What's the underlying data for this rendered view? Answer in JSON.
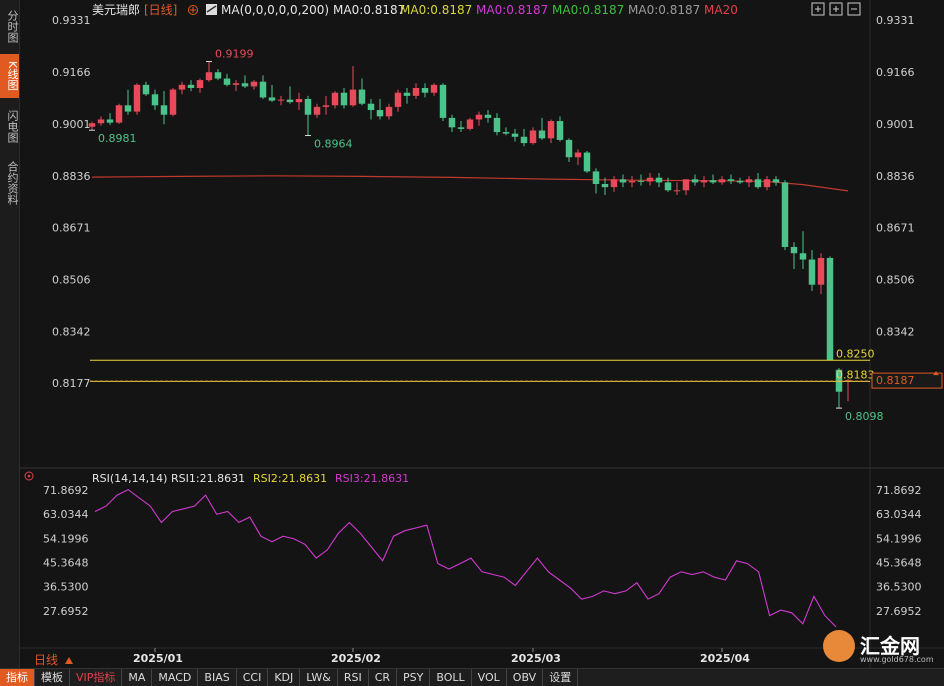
{
  "side_tabs": [
    "分时图",
    "K线图",
    "闪电图",
    "合约资料"
  ],
  "header": {
    "symbol": "美元瑞郎",
    "period": "[日线]",
    "period_icon": "circled-plus",
    "ma_title": "MA(0,0,0,0,0,200)",
    "ma_items": [
      {
        "label": "MA0:0.8187",
        "color": "#e6e6e6"
      },
      {
        "label": "MA0:0.8187",
        "color": "#d8d83a"
      },
      {
        "label": "MA0:0.8187",
        "color": "#d13ad1"
      },
      {
        "label": "MA0:0.8187",
        "color": "#3ac13a"
      },
      {
        "label": "MA0:0.8187",
        "color": "#9a9a9a"
      },
      {
        "label": "MA20",
        "color": "#e0404a"
      }
    ]
  },
  "rsi_header": {
    "title": "RSI(14,14,14)",
    "rsi1": "RSI1:21.8631",
    "rsi2": "RSI2:21.8631",
    "rsi3": "RSI3:21.8631"
  },
  "bottom_tabs": [
    "指标",
    "模板",
    "VIP指标",
    "MA",
    "MACD",
    "BIAS",
    "CCI",
    "KDJ",
    "LW&",
    "RSI",
    "CR",
    "PSY",
    "BOLL",
    "VOL",
    "OBV",
    "设置"
  ],
  "period_label": "日线",
  "logo": {
    "text": "汇金网",
    "url": "www.gold678.com"
  },
  "colors": {
    "up": "#e84a5a",
    "down": "#4cc38a",
    "ma_line": "#c0392b",
    "rsi_line": "#d13ad1",
    "level": "#e6d63a",
    "accent": "#e05a22"
  },
  "chart_data": [
    {
      "type": "candlestick",
      "title": "美元瑞郎 [日线]",
      "y_ticks": [
        "0.9331",
        "0.9166",
        "0.9001",
        "0.8836",
        "0.8671",
        "0.8506",
        "0.8342",
        "0.8177"
      ],
      "ylim": [
        0.8092,
        0.9331
      ],
      "x_labels": [
        {
          "index": 7,
          "label": "2025/01"
        },
        {
          "index": 29,
          "label": "2025/02"
        },
        {
          "index": 49,
          "label": "2025/03"
        },
        {
          "index": 70,
          "label": "2025/04"
        }
      ],
      "candles": [
        {
          "o": 0.8992,
          "h": 0.9008,
          "l": 0.8981,
          "c": 0.9003
        },
        {
          "o": 0.9003,
          "h": 0.9025,
          "l": 0.8995,
          "c": 0.9015
        },
        {
          "o": 0.9015,
          "h": 0.9035,
          "l": 0.8998,
          "c": 0.9005
        },
        {
          "o": 0.9005,
          "h": 0.9065,
          "l": 0.9001,
          "c": 0.906
        },
        {
          "o": 0.906,
          "h": 0.911,
          "l": 0.903,
          "c": 0.904
        },
        {
          "o": 0.904,
          "h": 0.913,
          "l": 0.903,
          "c": 0.9125
        },
        {
          "o": 0.9125,
          "h": 0.9135,
          "l": 0.909,
          "c": 0.9095
        },
        {
          "o": 0.9095,
          "h": 0.911,
          "l": 0.9045,
          "c": 0.906
        },
        {
          "o": 0.906,
          "h": 0.9105,
          "l": 0.9,
          "c": 0.903
        },
        {
          "o": 0.903,
          "h": 0.9115,
          "l": 0.9025,
          "c": 0.911
        },
        {
          "o": 0.911,
          "h": 0.9135,
          "l": 0.9095,
          "c": 0.9125
        },
        {
          "o": 0.9125,
          "h": 0.914,
          "l": 0.9105,
          "c": 0.9115
        },
        {
          "o": 0.9115,
          "h": 0.9145,
          "l": 0.91,
          "c": 0.914
        },
        {
          "o": 0.914,
          "h": 0.9199,
          "l": 0.9135,
          "c": 0.9165
        },
        {
          "o": 0.9165,
          "h": 0.9175,
          "l": 0.914,
          "c": 0.9145
        },
        {
          "o": 0.9145,
          "h": 0.916,
          "l": 0.912,
          "c": 0.9125
        },
        {
          "o": 0.9125,
          "h": 0.914,
          "l": 0.9105,
          "c": 0.913
        },
        {
          "o": 0.913,
          "h": 0.9155,
          "l": 0.9115,
          "c": 0.912
        },
        {
          "o": 0.912,
          "h": 0.914,
          "l": 0.911,
          "c": 0.9135
        },
        {
          "o": 0.9135,
          "h": 0.9155,
          "l": 0.908,
          "c": 0.9085
        },
        {
          "o": 0.9085,
          "h": 0.9125,
          "l": 0.907,
          "c": 0.9075
        },
        {
          "o": 0.9075,
          "h": 0.909,
          "l": 0.906,
          "c": 0.9078
        },
        {
          "o": 0.9078,
          "h": 0.912,
          "l": 0.9065,
          "c": 0.907
        },
        {
          "o": 0.907,
          "h": 0.91,
          "l": 0.9045,
          "c": 0.908
        },
        {
          "o": 0.908,
          "h": 0.909,
          "l": 0.8964,
          "c": 0.903
        },
        {
          "o": 0.903,
          "h": 0.9065,
          "l": 0.902,
          "c": 0.9055
        },
        {
          "o": 0.9055,
          "h": 0.909,
          "l": 0.903,
          "c": 0.906
        },
        {
          "o": 0.906,
          "h": 0.9105,
          "l": 0.905,
          "c": 0.91
        },
        {
          "o": 0.91,
          "h": 0.9115,
          "l": 0.905,
          "c": 0.906
        },
        {
          "o": 0.906,
          "h": 0.9185,
          "l": 0.9055,
          "c": 0.911
        },
        {
          "o": 0.911,
          "h": 0.9145,
          "l": 0.906,
          "c": 0.9065
        },
        {
          "o": 0.9065,
          "h": 0.908,
          "l": 0.9015,
          "c": 0.9045
        },
        {
          "o": 0.9045,
          "h": 0.908,
          "l": 0.9015,
          "c": 0.9025
        },
        {
          "o": 0.9025,
          "h": 0.9065,
          "l": 0.9015,
          "c": 0.9055
        },
        {
          "o": 0.9055,
          "h": 0.911,
          "l": 0.904,
          "c": 0.91
        },
        {
          "o": 0.91,
          "h": 0.9115,
          "l": 0.9065,
          "c": 0.909
        },
        {
          "o": 0.909,
          "h": 0.913,
          "l": 0.908,
          "c": 0.9115
        },
        {
          "o": 0.9115,
          "h": 0.913,
          "l": 0.9085,
          "c": 0.91
        },
        {
          "o": 0.91,
          "h": 0.913,
          "l": 0.909,
          "c": 0.9125
        },
        {
          "o": 0.9125,
          "h": 0.913,
          "l": 0.901,
          "c": 0.902
        },
        {
          "o": 0.902,
          "h": 0.903,
          "l": 0.8975,
          "c": 0.899
        },
        {
          "o": 0.899,
          "h": 0.901,
          "l": 0.8975,
          "c": 0.8985
        },
        {
          "o": 0.8985,
          "h": 0.902,
          "l": 0.898,
          "c": 0.9015
        },
        {
          "o": 0.9015,
          "h": 0.904,
          "l": 0.8995,
          "c": 0.903
        },
        {
          "o": 0.903,
          "h": 0.9045,
          "l": 0.9005,
          "c": 0.902
        },
        {
          "o": 0.902,
          "h": 0.9035,
          "l": 0.8965,
          "c": 0.8975
        },
        {
          "o": 0.8975,
          "h": 0.899,
          "l": 0.8965,
          "c": 0.897
        },
        {
          "o": 0.897,
          "h": 0.8985,
          "l": 0.8945,
          "c": 0.896
        },
        {
          "o": 0.896,
          "h": 0.8985,
          "l": 0.893,
          "c": 0.894
        },
        {
          "o": 0.894,
          "h": 0.899,
          "l": 0.8935,
          "c": 0.898
        },
        {
          "o": 0.898,
          "h": 0.902,
          "l": 0.895,
          "c": 0.8955
        },
        {
          "o": 0.8955,
          "h": 0.9015,
          "l": 0.894,
          "c": 0.901
        },
        {
          "o": 0.901,
          "h": 0.9025,
          "l": 0.8945,
          "c": 0.895
        },
        {
          "o": 0.895,
          "h": 0.8955,
          "l": 0.888,
          "c": 0.8895
        },
        {
          "o": 0.8895,
          "h": 0.892,
          "l": 0.887,
          "c": 0.891
        },
        {
          "o": 0.891,
          "h": 0.8915,
          "l": 0.8845,
          "c": 0.885
        },
        {
          "o": 0.885,
          "h": 0.886,
          "l": 0.878,
          "c": 0.881
        },
        {
          "o": 0.881,
          "h": 0.883,
          "l": 0.8775,
          "c": 0.88
        },
        {
          "o": 0.88,
          "h": 0.8835,
          "l": 0.8785,
          "c": 0.8825
        },
        {
          "o": 0.8825,
          "h": 0.884,
          "l": 0.88,
          "c": 0.8815
        },
        {
          "o": 0.8815,
          "h": 0.8835,
          "l": 0.88,
          "c": 0.882
        },
        {
          "o": 0.882,
          "h": 0.884,
          "l": 0.8805,
          "c": 0.8818
        },
        {
          "o": 0.8818,
          "h": 0.8845,
          "l": 0.8805,
          "c": 0.883
        },
        {
          "o": 0.883,
          "h": 0.8845,
          "l": 0.88,
          "c": 0.8815
        },
        {
          "o": 0.8815,
          "h": 0.883,
          "l": 0.8785,
          "c": 0.879
        },
        {
          "o": 0.879,
          "h": 0.8815,
          "l": 0.8775,
          "c": 0.879
        },
        {
          "o": 0.879,
          "h": 0.8825,
          "l": 0.8775,
          "c": 0.8825
        },
        {
          "o": 0.8825,
          "h": 0.884,
          "l": 0.8805,
          "c": 0.8815
        },
        {
          "o": 0.8815,
          "h": 0.8835,
          "l": 0.88,
          "c": 0.8822
        },
        {
          "o": 0.8822,
          "h": 0.884,
          "l": 0.881,
          "c": 0.8815
        },
        {
          "o": 0.8815,
          "h": 0.8835,
          "l": 0.8808,
          "c": 0.8825
        },
        {
          "o": 0.8825,
          "h": 0.884,
          "l": 0.881,
          "c": 0.882
        },
        {
          "o": 0.882,
          "h": 0.883,
          "l": 0.881,
          "c": 0.8815
        },
        {
          "o": 0.8815,
          "h": 0.8835,
          "l": 0.88,
          "c": 0.8825
        },
        {
          "o": 0.8825,
          "h": 0.8845,
          "l": 0.8795,
          "c": 0.88
        },
        {
          "o": 0.88,
          "h": 0.8835,
          "l": 0.879,
          "c": 0.8825
        },
        {
          "o": 0.8825,
          "h": 0.8835,
          "l": 0.8805,
          "c": 0.8815
        },
        {
          "o": 0.8815,
          "h": 0.8822,
          "l": 0.86,
          "c": 0.861
        },
        {
          "o": 0.861,
          "h": 0.8625,
          "l": 0.854,
          "c": 0.859
        },
        {
          "o": 0.859,
          "h": 0.866,
          "l": 0.854,
          "c": 0.857
        },
        {
          "o": 0.857,
          "h": 0.86,
          "l": 0.847,
          "c": 0.849
        },
        {
          "o": 0.849,
          "h": 0.859,
          "l": 0.846,
          "c": 0.8575
        },
        {
          "o": 0.8575,
          "h": 0.858,
          "l": 0.825,
          "c": 0.825
        },
        {
          "o": 0.822,
          "h": 0.8225,
          "l": 0.8098,
          "c": 0.815
        },
        {
          "o": 0.8183,
          "h": 0.819,
          "l": 0.812,
          "c": 0.8187
        }
      ],
      "ma_series": [
        {
          "name": "MA20",
          "points": [
            [
              0,
              0.8832
            ],
            [
              10,
              0.8834
            ],
            [
              20,
              0.8836
            ],
            [
              30,
              0.8834
            ],
            [
              40,
              0.8831
            ],
            [
              50,
              0.8826
            ],
            [
              60,
              0.8822
            ],
            [
              70,
              0.882
            ],
            [
              75,
              0.8818
            ],
            [
              79,
              0.8808
            ],
            [
              82,
              0.8796
            ],
            [
              84,
              0.8788
            ]
          ]
        }
      ],
      "levels": [
        {
          "value": 0.825,
          "label": "0.8250"
        },
        {
          "value": 0.8183,
          "label": "0.8183"
        }
      ],
      "current_price": {
        "value": 0.8187,
        "label": "0.8187"
      },
      "annotations": [
        {
          "index": 13,
          "value": 0.9199,
          "label": "0.9199",
          "kind": "high"
        },
        {
          "index": 0,
          "value": 0.8981,
          "label": "0.8981",
          "kind": "low"
        },
        {
          "index": 24,
          "value": 0.8964,
          "label": "0.8964",
          "kind": "low"
        },
        {
          "index": 83,
          "value": 0.8098,
          "label": "0.8098",
          "kind": "low"
        }
      ]
    },
    {
      "type": "line",
      "title": "RSI(14,14,14)",
      "y_ticks": [
        "71.8692",
        "63.0344",
        "54.1996",
        "45.3648",
        "36.5300",
        "27.6952"
      ],
      "ylim": [
        20.0,
        71.8692
      ],
      "series": [
        {
          "name": "RSI1",
          "values": [
            64,
            66,
            70,
            72,
            69,
            66,
            60,
            64,
            65,
            66,
            70,
            63,
            64,
            60,
            62,
            55,
            53,
            55,
            54,
            52,
            47,
            50,
            56,
            60,
            56,
            51,
            46,
            55,
            57,
            58,
            59,
            45,
            43,
            45,
            47,
            42,
            41,
            40,
            37,
            42,
            47,
            42,
            39,
            36,
            32,
            33,
            35,
            34,
            35,
            38,
            32,
            34,
            40,
            42,
            41,
            42,
            40,
            39,
            46,
            45,
            42,
            26,
            28,
            27,
            23,
            33,
            26,
            21.86
          ]
        }
      ]
    }
  ]
}
